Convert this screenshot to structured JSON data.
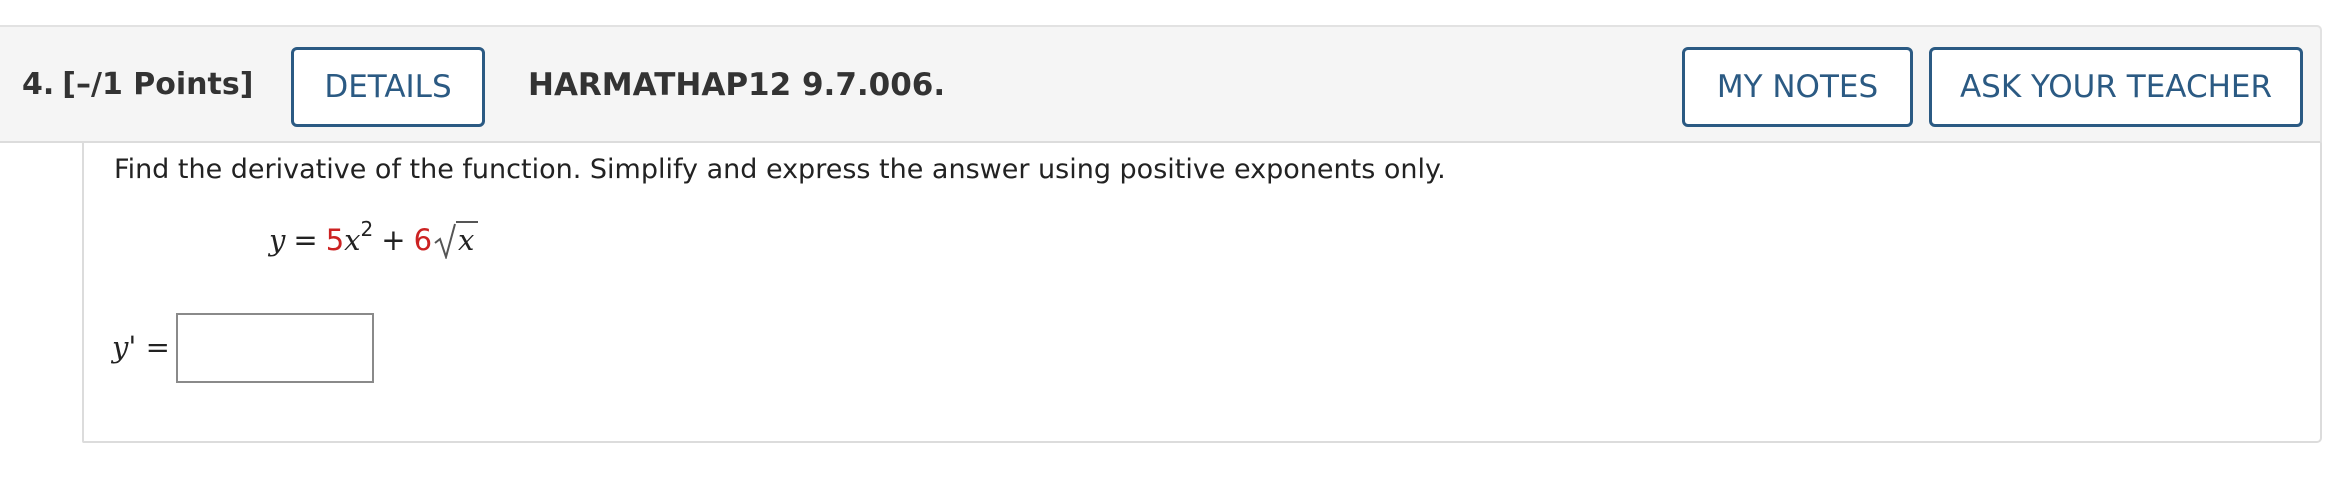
{
  "header": {
    "number": "4.",
    "points": "[–/1 Points]",
    "details_label": "DETAILS",
    "code": "HARMATHAP12 9.7.006.",
    "my_notes_label": "MY NOTES",
    "ask_teacher_label": "ASK YOUR TEACHER"
  },
  "body": {
    "instructions": "Find the derivative of the function. Simplify and express the answer using positive exponents only.",
    "equation": {
      "lhs": "y",
      "equals": "=",
      "coef1": "5",
      "var1": "x",
      "exp1": "2",
      "plus": "+",
      "coef2": "6",
      "radicand": "x"
    },
    "answer": {
      "label": "y' =",
      "value": "",
      "placeholder": ""
    }
  },
  "colors": {
    "accent": "#2b5a83",
    "coefficient": "#cc2222",
    "header_bg": "#f5f5f5"
  }
}
